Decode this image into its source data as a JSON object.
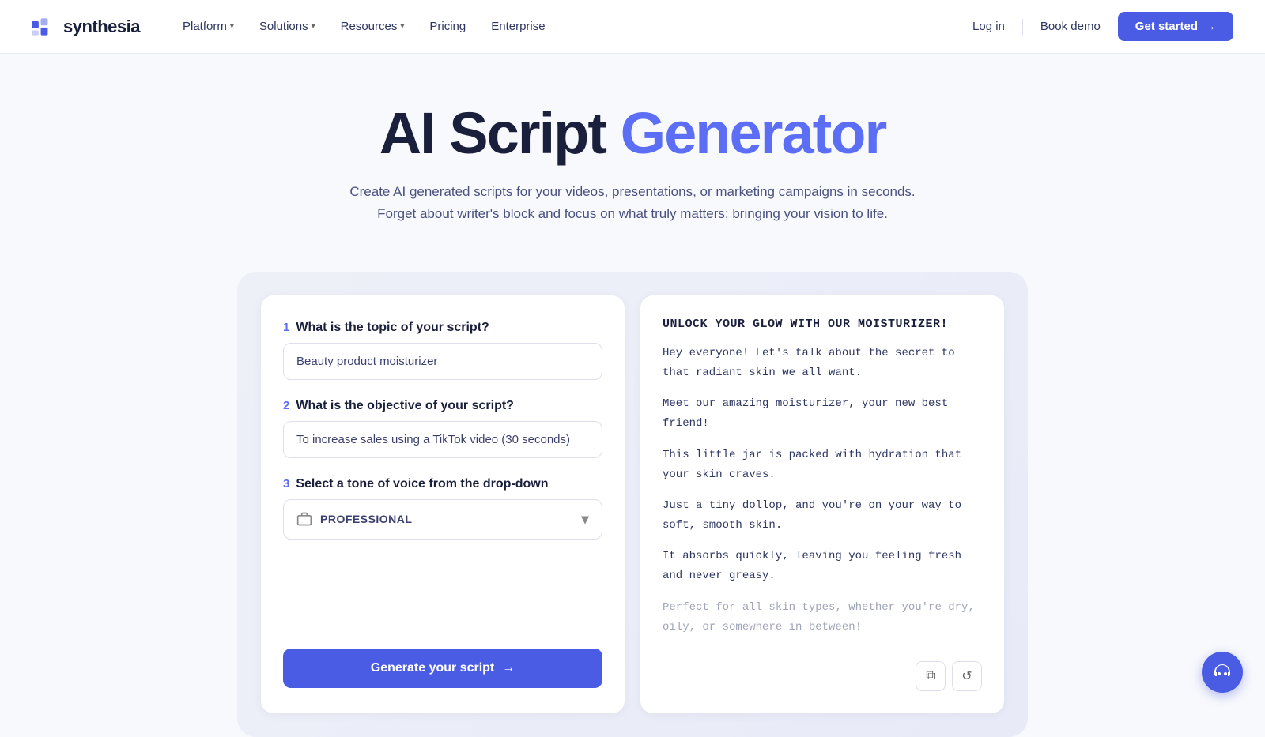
{
  "nav": {
    "logo_text": "synthesia",
    "items": [
      {
        "label": "Platform",
        "has_dropdown": true
      },
      {
        "label": "Solutions",
        "has_dropdown": true
      },
      {
        "label": "Resources",
        "has_dropdown": true
      },
      {
        "label": "Pricing",
        "has_dropdown": false
      },
      {
        "label": "Enterprise",
        "has_dropdown": false
      }
    ],
    "login_label": "Log in",
    "book_demo_label": "Book demo",
    "get_started_label": "Get started",
    "get_started_arrow": "→"
  },
  "hero": {
    "title_part1": "AI Script ",
    "title_accent": "Generator",
    "subtitle": "Create AI generated scripts for your videos, presentations, or marketing campaigns in seconds. Forget about writer's block and focus on what truly matters: bringing your vision to life."
  },
  "form": {
    "step1_num": "1",
    "step1_label": "What is the topic of your script?",
    "step1_placeholder": "Beauty product moisturizer",
    "step1_value": "Beauty product moisturizer",
    "step2_num": "2",
    "step2_label": "What is the objective of your script?",
    "step2_placeholder": "To increase sales using a TikTok video (30 seconds)",
    "step2_value": "To increase sales using a TikTok video (30 seconds)",
    "step3_num": "3",
    "step3_label": "Select a tone of voice from the drop-down",
    "tone_value": "PROFESSIONAL",
    "generate_label": "Generate your script",
    "generate_arrow": "→"
  },
  "output": {
    "title": "UNLOCK YOUR GLOW WITH OUR MOISTURIZER!",
    "paragraphs": [
      {
        "text": "Hey everyone! Let's talk about the secret to that radiant skin we all want.",
        "faded": false
      },
      {
        "text": "Meet our amazing moisturizer, your new best friend!",
        "faded": false
      },
      {
        "text": "This little jar is packed with hydration that your skin craves.",
        "faded": false
      },
      {
        "text": "Just a tiny dollop, and you're on your way to soft, smooth skin.",
        "faded": false
      },
      {
        "text": "It absorbs quickly, leaving you feeling fresh and never greasy.",
        "faded": false
      },
      {
        "text": "Perfect for all skin types, whether you're dry, oily, or somewhere in between!",
        "faded": true
      }
    ],
    "copy_icon": "⧉",
    "refresh_icon": "↺"
  }
}
